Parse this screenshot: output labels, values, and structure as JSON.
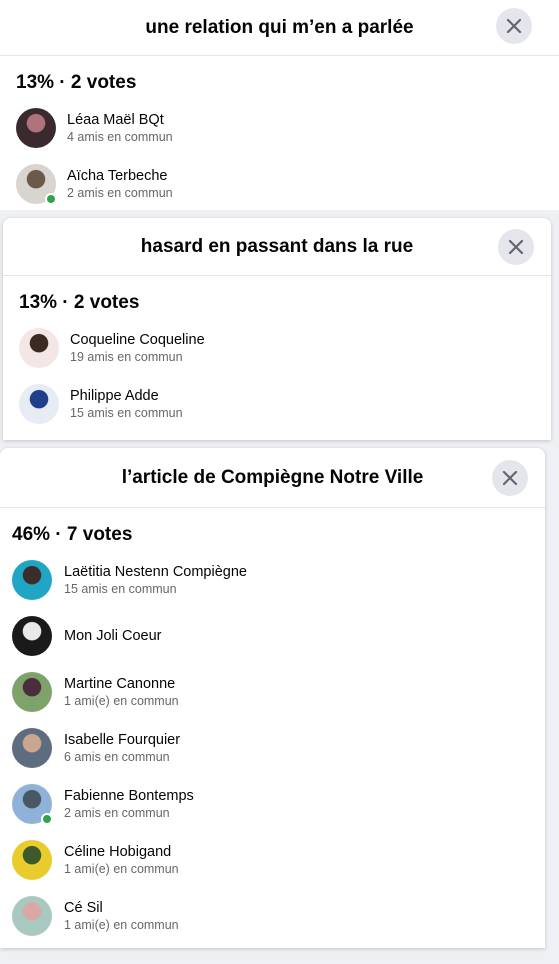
{
  "panels": [
    {
      "title": "une relation qui m’en a parlée",
      "summary": "13% · 2 votes",
      "voters": [
        {
          "name": "Léaa Maël BQt",
          "mutual": "4 amis en commun",
          "avatar_colors": [
            "#3a2a2e",
            "#b0727d"
          ],
          "online": false
        },
        {
          "name": "Aïcha Terbeche",
          "mutual": "2 amis en commun",
          "avatar_colors": [
            "#d8d4cf",
            "#6b5a4a"
          ],
          "online": true
        }
      ]
    },
    {
      "title": "hasard en passant dans la rue",
      "summary": "13% · 2 votes",
      "voters": [
        {
          "name": "Coqueline Coqueline",
          "mutual": "19 amis en commun",
          "avatar_colors": [
            "#f3e6e4",
            "#3b2a22"
          ],
          "online": false
        },
        {
          "name": "Philippe Adde",
          "mutual": "15 amis en commun",
          "avatar_colors": [
            "#e6ebf4",
            "#1f3f8a"
          ],
          "online": false
        }
      ]
    },
    {
      "title": "l’article de Compiègne Notre Ville",
      "summary": "46% · 7 votes",
      "voters": [
        {
          "name": "Laëtitia Nestenn Compiègne",
          "mutual": "15 amis en commun",
          "avatar_colors": [
            "#1fa6c4",
            "#3c2d2a"
          ],
          "online": false
        },
        {
          "name": "Mon Joli Coeur",
          "mutual": "",
          "avatar_colors": [
            "#1a1a1a",
            "#e9e9e9"
          ],
          "online": false
        },
        {
          "name": "Martine Canonne",
          "mutual": "1 ami(e) en commun",
          "avatar_colors": [
            "#7ea36a",
            "#4b2d3c"
          ],
          "online": false
        },
        {
          "name": "Isabelle Fourquier",
          "mutual": "6 amis en commun",
          "avatar_colors": [
            "#5d6c7e",
            "#c9a78f"
          ],
          "online": false
        },
        {
          "name": "Fabienne Bontemps",
          "mutual": "2 amis en commun",
          "avatar_colors": [
            "#8fb3d8",
            "#4a5866"
          ],
          "online": true
        },
        {
          "name": "Céline Hobigand",
          "mutual": "1 ami(e) en commun",
          "avatar_colors": [
            "#e8cc2c",
            "#3e5a2a"
          ],
          "online": false
        },
        {
          "name": "Cé Sil",
          "mutual": "1 ami(e) en commun",
          "avatar_colors": [
            "#a9c9c0",
            "#d9a8a4"
          ],
          "online": false
        }
      ]
    }
  ],
  "icons": {
    "close": "close-icon",
    "avatar": "avatar"
  }
}
